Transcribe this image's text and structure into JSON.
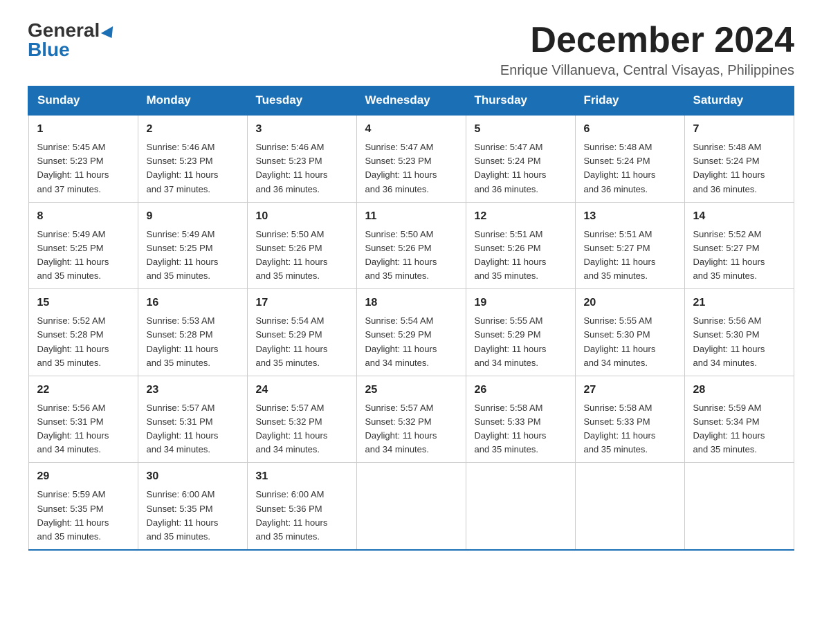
{
  "logo": {
    "general": "General",
    "blue": "Blue"
  },
  "title": "December 2024",
  "location": "Enrique Villanueva, Central Visayas, Philippines",
  "days_of_week": [
    "Sunday",
    "Monday",
    "Tuesday",
    "Wednesday",
    "Thursday",
    "Friday",
    "Saturday"
  ],
  "weeks": [
    [
      {
        "num": "1",
        "sunrise": "5:45 AM",
        "sunset": "5:23 PM",
        "daylight": "11 hours and 37 minutes."
      },
      {
        "num": "2",
        "sunrise": "5:46 AM",
        "sunset": "5:23 PM",
        "daylight": "11 hours and 37 minutes."
      },
      {
        "num": "3",
        "sunrise": "5:46 AM",
        "sunset": "5:23 PM",
        "daylight": "11 hours and 36 minutes."
      },
      {
        "num": "4",
        "sunrise": "5:47 AM",
        "sunset": "5:23 PM",
        "daylight": "11 hours and 36 minutes."
      },
      {
        "num": "5",
        "sunrise": "5:47 AM",
        "sunset": "5:24 PM",
        "daylight": "11 hours and 36 minutes."
      },
      {
        "num": "6",
        "sunrise": "5:48 AM",
        "sunset": "5:24 PM",
        "daylight": "11 hours and 36 minutes."
      },
      {
        "num": "7",
        "sunrise": "5:48 AM",
        "sunset": "5:24 PM",
        "daylight": "11 hours and 36 minutes."
      }
    ],
    [
      {
        "num": "8",
        "sunrise": "5:49 AM",
        "sunset": "5:25 PM",
        "daylight": "11 hours and 35 minutes."
      },
      {
        "num": "9",
        "sunrise": "5:49 AM",
        "sunset": "5:25 PM",
        "daylight": "11 hours and 35 minutes."
      },
      {
        "num": "10",
        "sunrise": "5:50 AM",
        "sunset": "5:26 PM",
        "daylight": "11 hours and 35 minutes."
      },
      {
        "num": "11",
        "sunrise": "5:50 AM",
        "sunset": "5:26 PM",
        "daylight": "11 hours and 35 minutes."
      },
      {
        "num": "12",
        "sunrise": "5:51 AM",
        "sunset": "5:26 PM",
        "daylight": "11 hours and 35 minutes."
      },
      {
        "num": "13",
        "sunrise": "5:51 AM",
        "sunset": "5:27 PM",
        "daylight": "11 hours and 35 minutes."
      },
      {
        "num": "14",
        "sunrise": "5:52 AM",
        "sunset": "5:27 PM",
        "daylight": "11 hours and 35 minutes."
      }
    ],
    [
      {
        "num": "15",
        "sunrise": "5:52 AM",
        "sunset": "5:28 PM",
        "daylight": "11 hours and 35 minutes."
      },
      {
        "num": "16",
        "sunrise": "5:53 AM",
        "sunset": "5:28 PM",
        "daylight": "11 hours and 35 minutes."
      },
      {
        "num": "17",
        "sunrise": "5:54 AM",
        "sunset": "5:29 PM",
        "daylight": "11 hours and 35 minutes."
      },
      {
        "num": "18",
        "sunrise": "5:54 AM",
        "sunset": "5:29 PM",
        "daylight": "11 hours and 34 minutes."
      },
      {
        "num": "19",
        "sunrise": "5:55 AM",
        "sunset": "5:29 PM",
        "daylight": "11 hours and 34 minutes."
      },
      {
        "num": "20",
        "sunrise": "5:55 AM",
        "sunset": "5:30 PM",
        "daylight": "11 hours and 34 minutes."
      },
      {
        "num": "21",
        "sunrise": "5:56 AM",
        "sunset": "5:30 PM",
        "daylight": "11 hours and 34 minutes."
      }
    ],
    [
      {
        "num": "22",
        "sunrise": "5:56 AM",
        "sunset": "5:31 PM",
        "daylight": "11 hours and 34 minutes."
      },
      {
        "num": "23",
        "sunrise": "5:57 AM",
        "sunset": "5:31 PM",
        "daylight": "11 hours and 34 minutes."
      },
      {
        "num": "24",
        "sunrise": "5:57 AM",
        "sunset": "5:32 PM",
        "daylight": "11 hours and 34 minutes."
      },
      {
        "num": "25",
        "sunrise": "5:57 AM",
        "sunset": "5:32 PM",
        "daylight": "11 hours and 34 minutes."
      },
      {
        "num": "26",
        "sunrise": "5:58 AM",
        "sunset": "5:33 PM",
        "daylight": "11 hours and 35 minutes."
      },
      {
        "num": "27",
        "sunrise": "5:58 AM",
        "sunset": "5:33 PM",
        "daylight": "11 hours and 35 minutes."
      },
      {
        "num": "28",
        "sunrise": "5:59 AM",
        "sunset": "5:34 PM",
        "daylight": "11 hours and 35 minutes."
      }
    ],
    [
      {
        "num": "29",
        "sunrise": "5:59 AM",
        "sunset": "5:35 PM",
        "daylight": "11 hours and 35 minutes."
      },
      {
        "num": "30",
        "sunrise": "6:00 AM",
        "sunset": "5:35 PM",
        "daylight": "11 hours and 35 minutes."
      },
      {
        "num": "31",
        "sunrise": "6:00 AM",
        "sunset": "5:36 PM",
        "daylight": "11 hours and 35 minutes."
      },
      null,
      null,
      null,
      null
    ]
  ],
  "labels": {
    "sunrise": "Sunrise:",
    "sunset": "Sunset:",
    "daylight": "Daylight:"
  }
}
